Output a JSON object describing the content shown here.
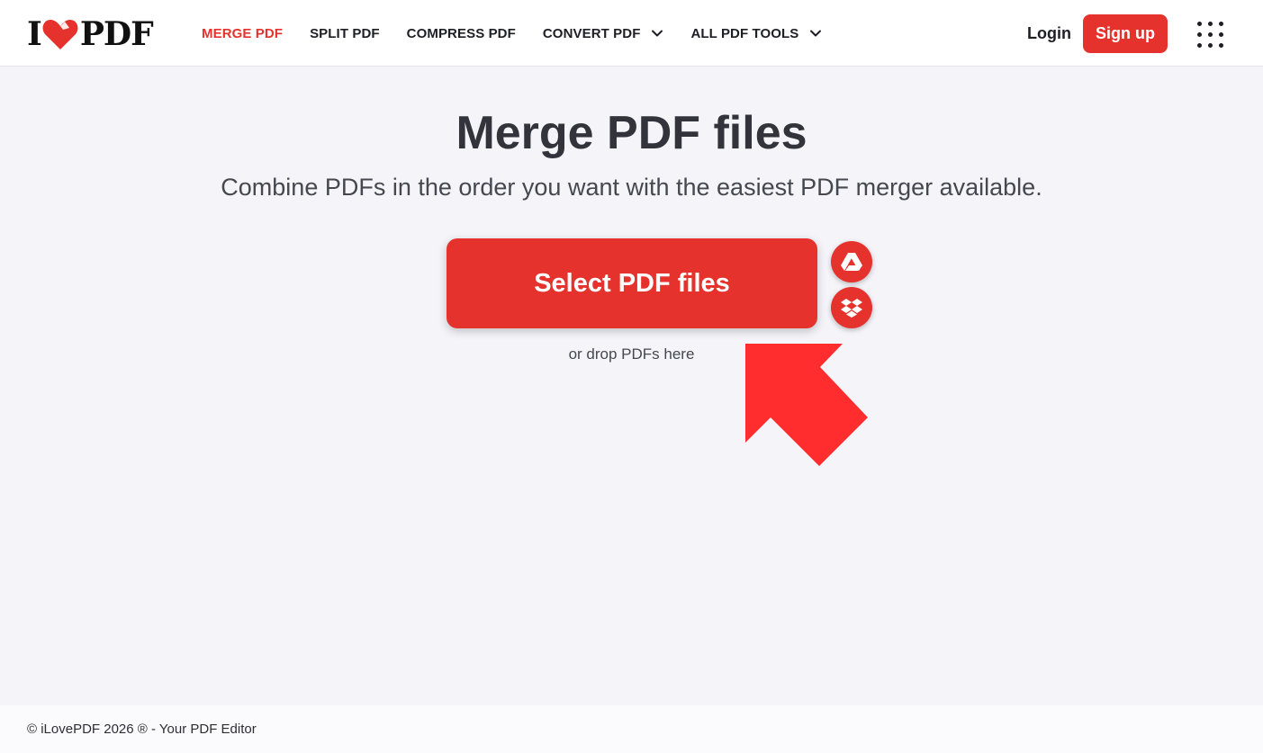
{
  "header": {
    "logo": {
      "left": "I",
      "right": "PDF",
      "icon": "heart-icon"
    },
    "nav": [
      {
        "label": "MERGE PDF",
        "active": true,
        "dropdown": false
      },
      {
        "label": "SPLIT PDF",
        "active": false,
        "dropdown": false
      },
      {
        "label": "COMPRESS PDF",
        "active": false,
        "dropdown": false
      },
      {
        "label": "CONVERT PDF",
        "active": false,
        "dropdown": true
      },
      {
        "label": "ALL PDF TOOLS",
        "active": false,
        "dropdown": true
      }
    ],
    "login_label": "Login",
    "signup_label": "Sign up",
    "apps_icon": "grid-menu-icon"
  },
  "main": {
    "title": "Merge PDF files",
    "subtitle": "Combine PDFs in the order you want with the easiest PDF merger available.",
    "select_button_label": "Select PDF files",
    "cloud_sources": [
      {
        "name": "Google Drive",
        "icon": "google-drive-icon"
      },
      {
        "name": "Dropbox",
        "icon": "dropbox-icon"
      }
    ],
    "drop_hint": "or drop PDFs here",
    "pointer_icon": "arrow-pointer-icon"
  },
  "footer": {
    "copyright": "© iLovePDF 2026 ® - Your PDF Editor"
  },
  "colors": {
    "brand": "#e5322d",
    "background": "#f4f4f9",
    "text": "#33333b",
    "arrow": "#ff2d2d"
  }
}
